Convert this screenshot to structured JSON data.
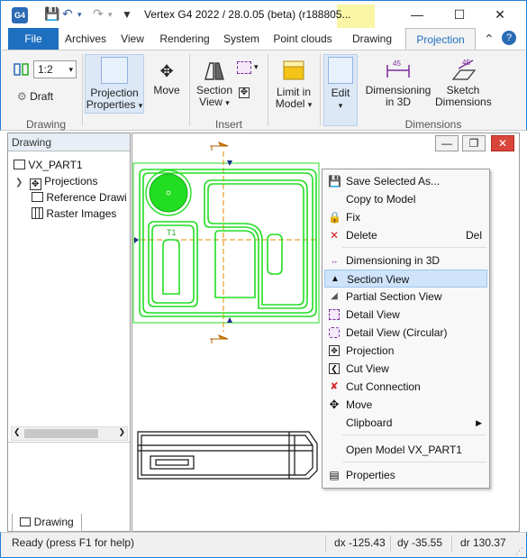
{
  "titlebar": {
    "app_icon": "G4",
    "title": "Vertex G4 2022 / 28.0.05 (beta) (r188805..."
  },
  "tabs": [
    {
      "label": "File"
    },
    {
      "label": "Archives"
    },
    {
      "label": "View"
    },
    {
      "label": "Rendering"
    },
    {
      "label": "System"
    },
    {
      "label": "Point clouds"
    },
    {
      "label": "Drawing"
    },
    {
      "label": "Projection"
    }
  ],
  "ribbon": {
    "scale_value": "1:2",
    "draft_label": "Draft",
    "drawing_group": "Drawing",
    "projection_properties": "Projection Properties",
    "move": "Move",
    "section_view": "Section View",
    "insert_group": "Insert",
    "limit_in_model": "Limit in Model",
    "edit": "Edit",
    "dimensioning_3d": "Dimensioning in 3D",
    "sketch_dimensions": "Sketch Dimensions",
    "dimensions_group": "Dimensions"
  },
  "left_panel": {
    "header": "Drawing",
    "tree": [
      {
        "label": "VX_PART1"
      },
      {
        "label": "Projections"
      },
      {
        "label": "Reference Drawi"
      },
      {
        "label": "Raster Images"
      }
    ],
    "bottom_tab": "Drawing"
  },
  "drawing_labels": {
    "t1": "T1"
  },
  "context_menu": {
    "items": [
      {
        "label": "Save Selected As...",
        "icon": "save-icon",
        "shortcut": ""
      },
      {
        "label": "Copy to Model",
        "icon": "",
        "shortcut": ""
      },
      {
        "label": "Fix",
        "icon": "lock-icon",
        "shortcut": ""
      },
      {
        "label": "Delete",
        "icon": "delete-icon",
        "shortcut": "Del"
      },
      {
        "label": "Dimensioning in 3D",
        "icon": "dimension-icon",
        "shortcut": ""
      },
      {
        "label": "Section View",
        "icon": "section-view-icon",
        "shortcut": ""
      },
      {
        "label": "Partial Section View",
        "icon": "partial-section-icon",
        "shortcut": ""
      },
      {
        "label": "Detail View",
        "icon": "detail-view-icon",
        "shortcut": ""
      },
      {
        "label": "Detail View (Circular)",
        "icon": "detail-circular-icon",
        "shortcut": ""
      },
      {
        "label": "Projection",
        "icon": "projection-icon",
        "shortcut": ""
      },
      {
        "label": "Cut View",
        "icon": "cut-view-icon",
        "shortcut": ""
      },
      {
        "label": "Cut Connection",
        "icon": "cut-connection-icon",
        "shortcut": ""
      },
      {
        "label": "Move",
        "icon": "move-icon",
        "shortcut": ""
      },
      {
        "label": "Clipboard",
        "icon": "",
        "shortcut": ""
      },
      {
        "label": "Open Model VX_PART1",
        "icon": "",
        "shortcut": ""
      },
      {
        "label": "Properties",
        "icon": "properties-icon",
        "shortcut": ""
      }
    ]
  },
  "statusbar": {
    "message": "Ready (press F1 for help)",
    "dx": "dx -125.43",
    "dy": "dy -35.55",
    "dr": "dr 130.37"
  },
  "colors": {
    "accent": "#1e6fc0",
    "geometry": "#22dd22",
    "highlight": "#cfe3fa",
    "close_red": "#d9453a"
  }
}
